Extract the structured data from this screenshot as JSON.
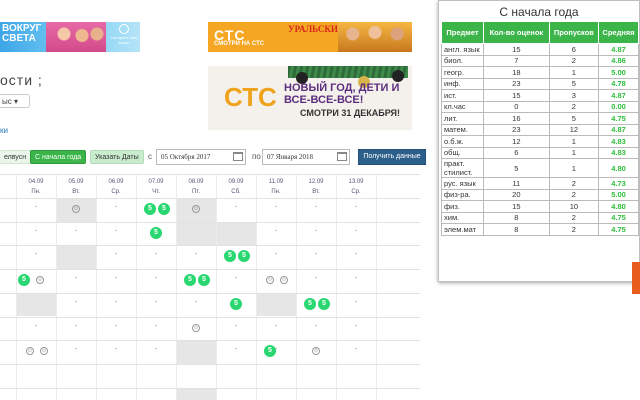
{
  "banners": {
    "left": {
      "title": "Вокруг света",
      "logo_text": "Смотрите наш канал"
    },
    "top": {
      "logo": "СТС",
      "sub": "СМОТРИ НА СТС",
      "show": "Уральские пельмени"
    },
    "newyear": {
      "logo": "СТС",
      "text": "НОВЫЙ ГОД, ДЕТИ И ВСЕ-ВСЕ-ВСЕ!",
      "date": "СМОТРИ 31 ДЕКАБРЯ!"
    }
  },
  "page": {
    "title": "ости ;",
    "class_select": "ыс ▾",
    "back_link": "ки"
  },
  "toolbar": {
    "weeks_label": "елвусн",
    "year_label": "С начала года",
    "dates_label": "Указать Даты",
    "from_label": "с",
    "to_label": "по",
    "date_from": "05 Октября 2017",
    "date_to": "07 Января 2018",
    "get_label": "Получить данные"
  },
  "grid": {
    "columns": [
      {
        "date": "04.09",
        "day": "Пн."
      },
      {
        "date": "05.09",
        "day": "Вт."
      },
      {
        "date": "06.09",
        "day": "Ср."
      },
      {
        "date": "07.09",
        "day": "Чт."
      },
      {
        "date": "08.09",
        "day": "Пт."
      },
      {
        "date": "09.09",
        "day": "Сб."
      },
      {
        "date": "11.09",
        "day": "Пн."
      },
      {
        "date": "12.09",
        "day": "Вт."
      },
      {
        "date": "13.09",
        "day": "Ср."
      }
    ],
    "dash": "-",
    "mark": "5",
    "absent": "⊙"
  },
  "popup": {
    "title": "С начала года",
    "headers": [
      "Предмет",
      "Кол-во оценок",
      "Пропусков",
      "Средняя"
    ],
    "rows": [
      [
        "англ. язык",
        "15",
        "6",
        "4.87"
      ],
      [
        "биол.",
        "7",
        "2",
        "4.86"
      ],
      [
        "геогр.",
        "18",
        "1",
        "5.00"
      ],
      [
        "инф.",
        "23",
        "5",
        "4.78"
      ],
      [
        "ист.",
        "15",
        "3",
        "4.87"
      ],
      [
        "кл.час",
        "0",
        "2",
        "0.00"
      ],
      [
        "лит.",
        "16",
        "5",
        "4.75"
      ],
      [
        "матем.",
        "23",
        "12",
        "4.87"
      ],
      [
        "о.б.ж.",
        "12",
        "1",
        "4.83"
      ],
      [
        "общ.",
        "6",
        "1",
        "4.83"
      ],
      [
        "практ. стилист.",
        "5",
        "1",
        "4.80"
      ],
      [
        "рус. язык",
        "11",
        "2",
        "4.73"
      ],
      [
        "физ-ра.",
        "20",
        "2",
        "5.00"
      ],
      [
        "физ.",
        "15",
        "10",
        "4.80"
      ],
      [
        "хим.",
        "8",
        "2",
        "4.75"
      ],
      [
        "элем.мат",
        "8",
        "2",
        "4.75"
      ]
    ]
  },
  "colors": {
    "accent_green": "#3bb54a",
    "mark_green": "#28d76f",
    "avg_green": "#2cbd3a",
    "button_blue": "#2c5f8a"
  }
}
